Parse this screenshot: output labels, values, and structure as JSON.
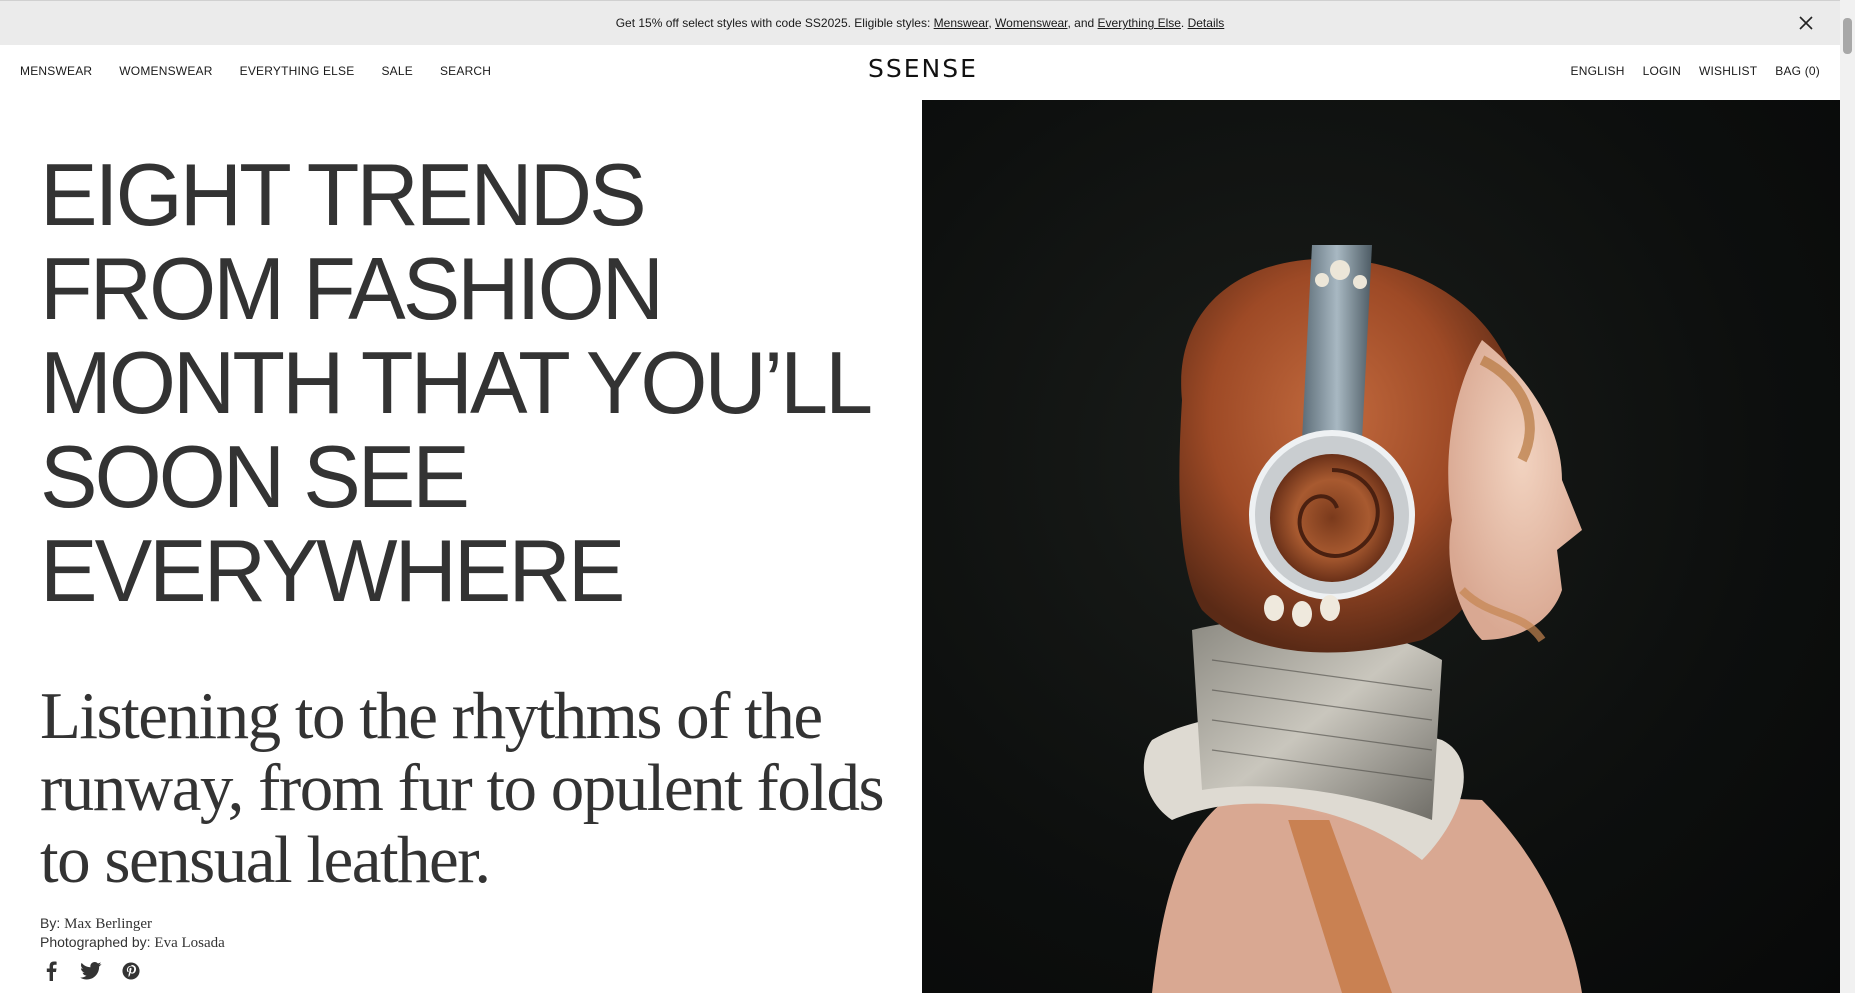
{
  "promo": {
    "text_before": "Get 15% off select styles with code SS2025. Eligible styles: ",
    "link_menswear": "Menswear",
    "sep1": ", ",
    "link_womenswear": "Womenswear",
    "sep2": ", and ",
    "link_everything_else": "Everything Else",
    "sep3": ". ",
    "link_details": "Details"
  },
  "nav": {
    "left": [
      "MENSWEAR",
      "WOMENSWEAR",
      "EVERYTHING ELSE",
      "SALE",
      "SEARCH"
    ],
    "right": [
      "ENGLISH",
      "LOGIN",
      "WISHLIST",
      "BAG (0)"
    ],
    "logo": "SSENSE"
  },
  "article": {
    "headline": "EIGHT TRENDS FROM FASHION MONTH THAT YOU’LL SOON SEE EVERYWHERE",
    "dek": "Listening to the rhythms of the runway, from fur to opulent folds to sensual leather.",
    "by_label": "By: ",
    "author": "Max Berlinger",
    "photo_label": "Photographed by: ",
    "photographer": "Eva Losada"
  },
  "icons": {
    "close": "close-icon",
    "facebook": "facebook-icon",
    "twitter": "twitter-icon",
    "pinterest": "pinterest-icon"
  }
}
